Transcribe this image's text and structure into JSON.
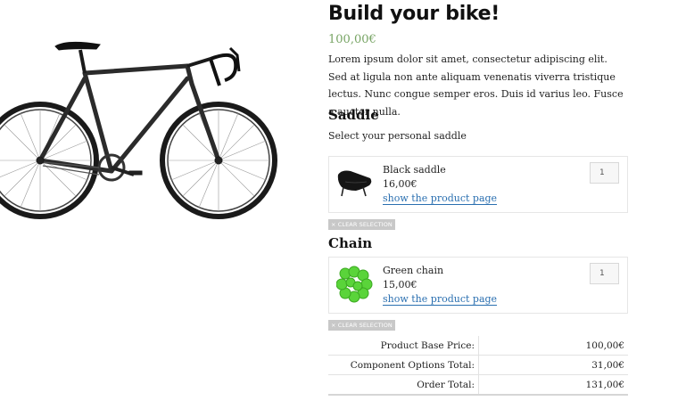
{
  "product": {
    "title": "Build your bike!",
    "price": "100,00€",
    "description": "Lorem ipsum dolor sit amet, consectetur adipiscing elit. Sed at ligula non ante aliquam venenatis viverra tristique lectus. Nunc congue semper eros. Duis id varius leo. Fusce a auctor nulla."
  },
  "components": [
    {
      "section_title": "Saddle",
      "section_subtitle": "Select your personal saddle",
      "option_name": "Black saddle",
      "option_price": "16,00€",
      "link_label": "show the product page",
      "quantity": "1",
      "clear_label": "× CLEAR SELECTION"
    },
    {
      "section_title": "Chain",
      "option_name": "Green chain",
      "option_price": "15,00€",
      "link_label": "show the product page",
      "quantity": "1",
      "clear_label": "× CLEAR SELECTION"
    }
  ],
  "totals": {
    "base_label": "Product Base Price:",
    "base_value": "100,00€",
    "options_label": "Component Options Total:",
    "options_value": "31,00€",
    "order_label": "Order Total:",
    "order_value": "131,00€"
  },
  "colors": {
    "price_green": "#77a464",
    "link_blue": "#2a6fb0",
    "clear_button_bg": "#c8c8c8"
  },
  "icons": {
    "main_image": "road-bike-image",
    "saddle_thumb": "black-saddle-image",
    "chain_thumb": "green-chain-image"
  }
}
